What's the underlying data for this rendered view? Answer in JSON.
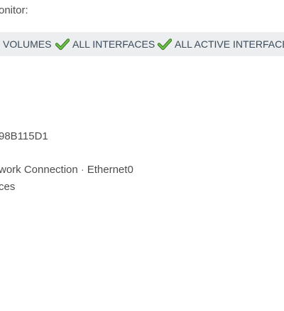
{
  "header": {
    "title_fragment": "onitor:"
  },
  "options": {
    "volumes_label": "VOLUMES",
    "all_interfaces_label": "ALL INTERFACES",
    "all_active_interfaces_label": "ALL ACTIVE INTERFACES",
    "check_color": "#5aa832"
  },
  "details": {
    "id_fragment": "98B115D1",
    "connection_fragment": "work Connection",
    "separator": "·",
    "interface_name": "Ethernet0",
    "interfaces_fragment": "ces"
  },
  "colors": {
    "bar_background": "#eceeef",
    "text": "#4d4d4d"
  }
}
